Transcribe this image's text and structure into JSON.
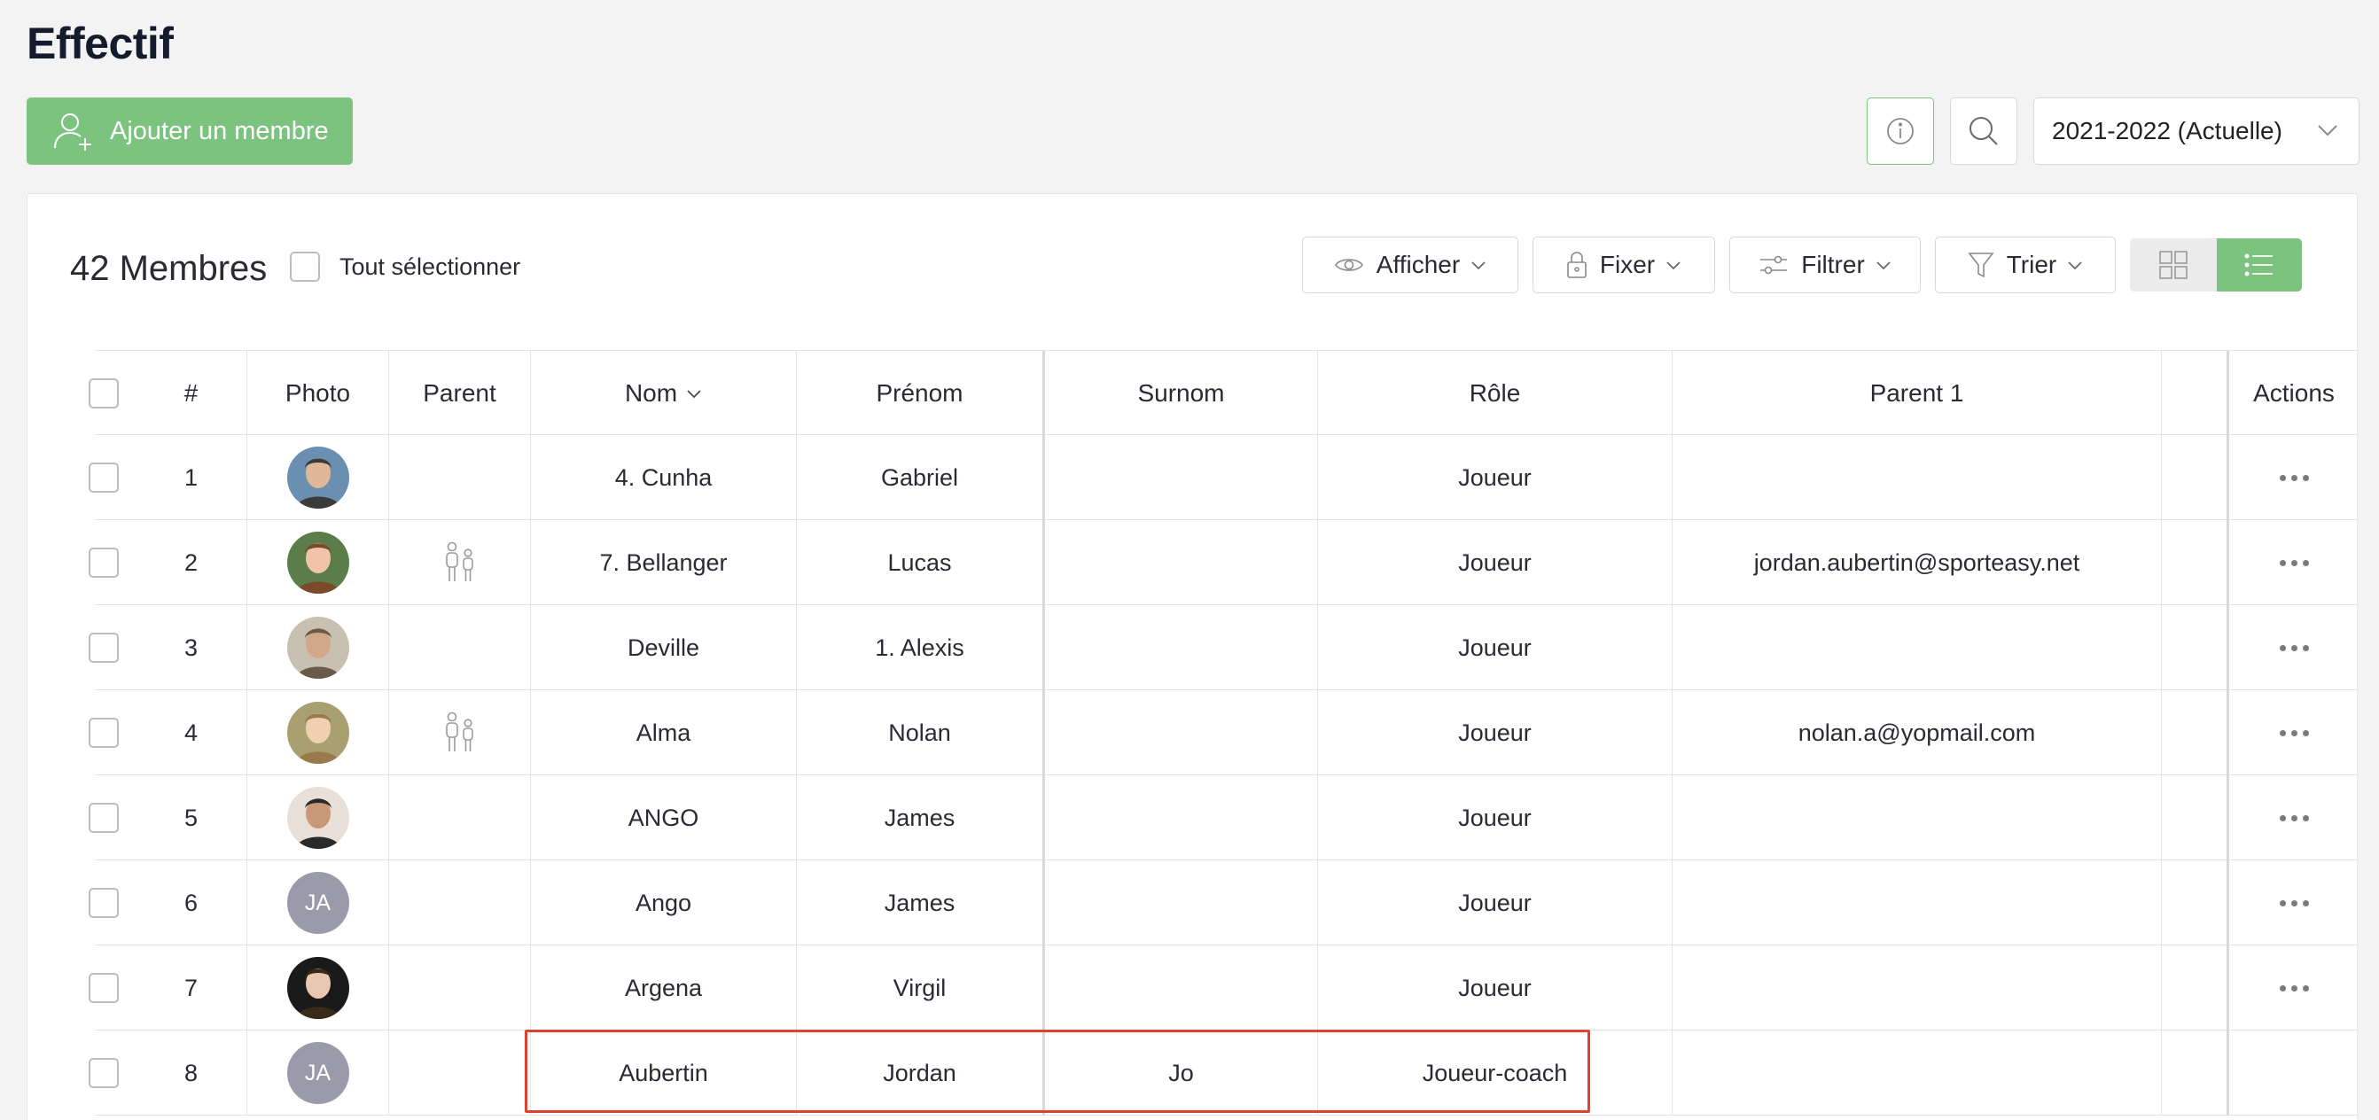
{
  "page": {
    "title": "Effectif"
  },
  "toolbar": {
    "add_member_label": "Ajouter un membre",
    "season_selected": "2021-2022 (Actuelle)"
  },
  "list_header": {
    "count_label": "42 Membres",
    "select_all_label": "Tout sélectionner",
    "display_label": "Afficher",
    "pin_label": "Fixer",
    "filter_label": "Filtrer",
    "sort_label": "Trier"
  },
  "table": {
    "columns": {
      "num": "#",
      "photo": "Photo",
      "parent": "Parent",
      "nom": "Nom",
      "prenom": "Prénom",
      "surnom": "Surnom",
      "role": "Rôle",
      "parent1": "Parent 1",
      "actions": "Actions"
    },
    "rows": [
      {
        "num": "1",
        "avatar": "photo",
        "has_parent": false,
        "nom": "4. Cunha",
        "prenom": "Gabriel",
        "surnom": "",
        "role": "Joueur",
        "parent1": "",
        "actions": true
      },
      {
        "num": "2",
        "avatar": "photo",
        "has_parent": true,
        "nom": "7. Bellanger",
        "prenom": "Lucas",
        "surnom": "",
        "role": "Joueur",
        "parent1": "jordan.aubertin@sporteasy.net",
        "actions": true
      },
      {
        "num": "3",
        "avatar": "photo",
        "has_parent": false,
        "nom": "Deville",
        "prenom": "1. Alexis",
        "surnom": "",
        "role": "Joueur",
        "parent1": "",
        "actions": true
      },
      {
        "num": "4",
        "avatar": "photo",
        "has_parent": true,
        "nom": "Alma",
        "prenom": "Nolan",
        "surnom": "",
        "role": "Joueur",
        "parent1": "nolan.a@yopmail.com",
        "actions": true
      },
      {
        "num": "5",
        "avatar": "photo",
        "has_parent": false,
        "nom": "ANGO",
        "prenom": "James",
        "surnom": "",
        "role": "Joueur",
        "parent1": "",
        "actions": true
      },
      {
        "num": "6",
        "avatar": "JA",
        "has_parent": false,
        "nom": "Ango",
        "prenom": "James",
        "surnom": "",
        "role": "Joueur",
        "parent1": "",
        "actions": true
      },
      {
        "num": "7",
        "avatar": "photo",
        "has_parent": false,
        "nom": "Argena",
        "prenom": "Virgil",
        "surnom": "",
        "role": "Joueur",
        "parent1": "",
        "actions": true
      },
      {
        "num": "8",
        "avatar": "JA",
        "has_parent": false,
        "nom": "Aubertin",
        "prenom": "Jordan",
        "surnom": "Jo",
        "role": "Joueur-coach",
        "parent1": "",
        "actions": false
      }
    ]
  },
  "colors": {
    "accent_green": "#7bc37f",
    "highlight_red": "#e0412e",
    "initials_bg": "#9a9aaa"
  }
}
